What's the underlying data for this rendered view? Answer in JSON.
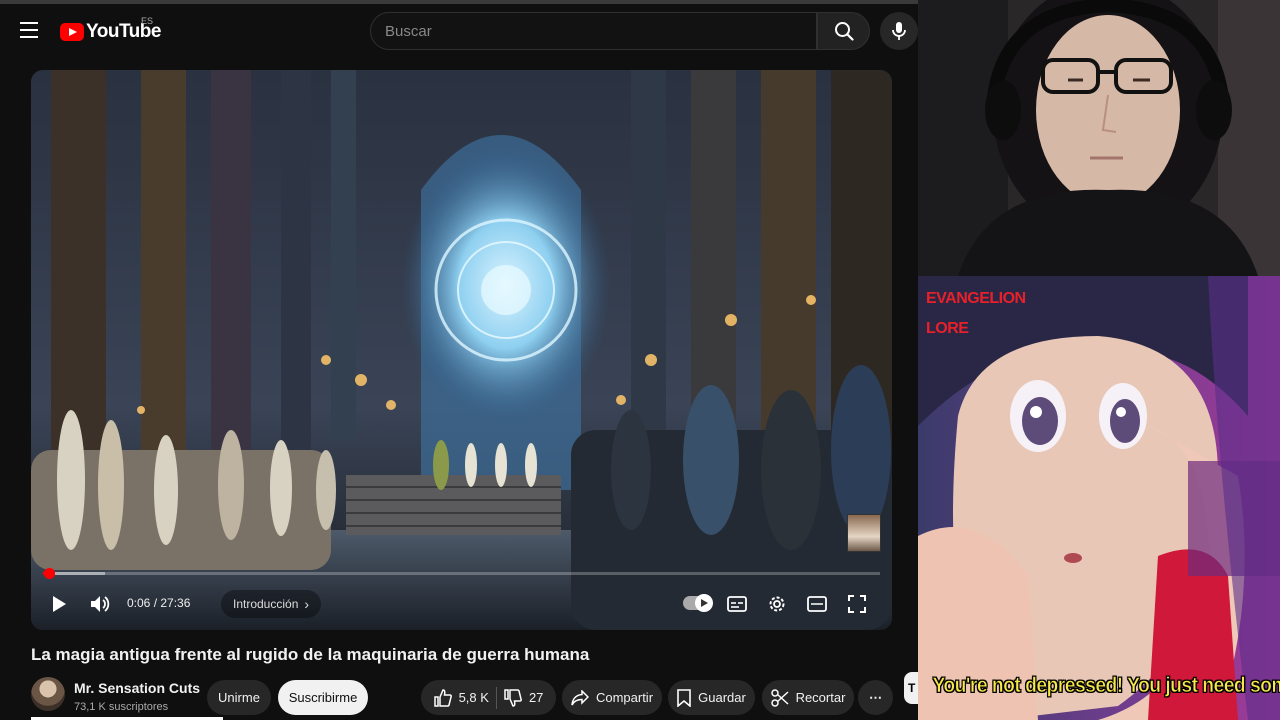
{
  "youtube": {
    "logo_text": "YouTube",
    "region_badge": "ES",
    "search": {
      "placeholder": "Buscar",
      "value": ""
    }
  },
  "player": {
    "current_time": "0:06",
    "duration": "27:36",
    "time_display": "0:06 / 27:36",
    "chapter": "Introducción",
    "progress_fraction": 0.004,
    "buffered_fraction": 0.05
  },
  "video": {
    "title": "La magia antigua frente al rugido de la maquinaria de guerra humana",
    "channel_name": "Mr. Sensation Cuts",
    "subscribers": "73,1 K suscriptores",
    "join_label": "Unirme",
    "subscribe_label": "Suscribirme",
    "likes": "5,8 K",
    "dislikes": "27",
    "share_label": "Compartir",
    "save_label": "Guardar",
    "clip_label": "Recortar",
    "more_label": "⋯",
    "edge_label": "T"
  },
  "overlay": {
    "anime_title_line1": "EVANGELION",
    "anime_title_line2": "LORE",
    "caption": "You're not depressed! You just need some sex!"
  },
  "colors": {
    "accent": "#ff0000",
    "background": "#0f0f0f",
    "caption": "#f6e84a",
    "anime_title": "#e8202a"
  }
}
